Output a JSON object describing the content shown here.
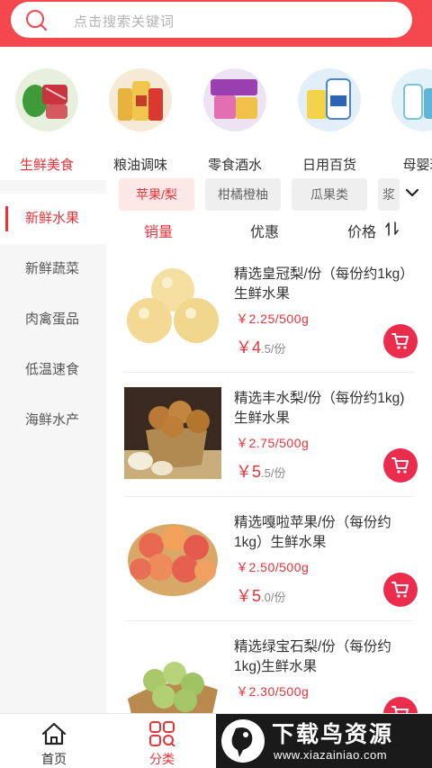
{
  "search": {
    "placeholder": "点击搜索关键词"
  },
  "categories": [
    {
      "label": "生鲜美食",
      "icon": "meat-vegetable-image"
    },
    {
      "label": "粮油调味",
      "icon": "oil-bottles-image"
    },
    {
      "label": "零食酒水",
      "icon": "snacks-image"
    },
    {
      "label": "日用百货",
      "icon": "detergent-image"
    },
    {
      "label": "母婴玩",
      "icon": "baby-bottle-image"
    }
  ],
  "sidebar": {
    "items": [
      {
        "label": "新鲜水果"
      },
      {
        "label": "新鲜蔬菜"
      },
      {
        "label": "肉禽蛋品"
      },
      {
        "label": "低温速食"
      },
      {
        "label": "海鲜水产"
      }
    ]
  },
  "chips": [
    {
      "label": "苹果/梨"
    },
    {
      "label": "柑橘橙柚"
    },
    {
      "label": "瓜果类"
    },
    {
      "label": "浆"
    }
  ],
  "sort": {
    "sales": "销量",
    "discount": "优惠",
    "price": "价格"
  },
  "products": [
    {
      "name": "精选皇冠梨/份（每份约1kg）生鲜水果",
      "unit_price": "￥2.25/500g",
      "price_symbol": "￥",
      "price_int": "4",
      "price_dec": ".5/份"
    },
    {
      "name": "精选丰水梨/份（每份约1kg)生鲜水果",
      "unit_price": "￥2.75/500g",
      "price_symbol": "￥",
      "price_int": "5",
      "price_dec": ".5/份"
    },
    {
      "name": "精选嘎啦苹果/份（每份约1kg）生鲜水果",
      "unit_price": "￥2.50/500g",
      "price_symbol": "￥",
      "price_int": "5",
      "price_dec": ".0/份"
    },
    {
      "name": "精选绿宝石梨/份（每份约1kg)生鲜水果",
      "unit_price": "￥2.30/500g",
      "price_symbol": "",
      "price_int": "",
      "price_dec": ""
    }
  ],
  "tabbar": {
    "home": "首页",
    "category": "分类"
  },
  "watermark": {
    "title": "下载鸟资源",
    "url": "www.xiazainiao.com"
  },
  "colors": {
    "brand": "#f5484e",
    "accent": "#e9333a",
    "cart": "#eb2c4d"
  }
}
